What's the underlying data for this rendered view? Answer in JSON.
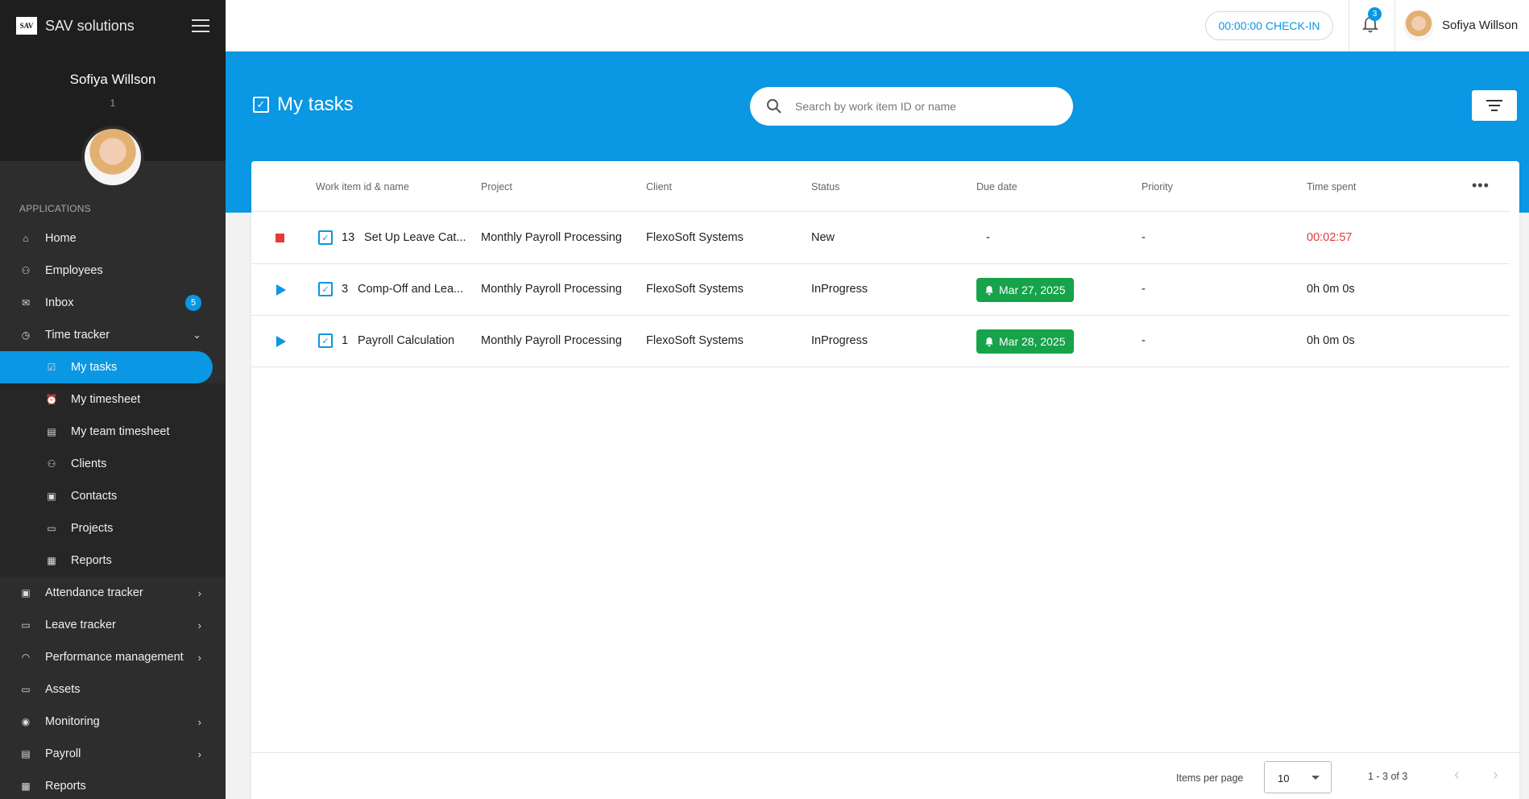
{
  "app": {
    "logo_text": "SAV",
    "brand": "SAV solutions"
  },
  "profile": {
    "name": "Sofiya Willson",
    "id": "1"
  },
  "sidebar": {
    "section_label": "APPLICATIONS",
    "items": [
      {
        "label": "Home",
        "icon": "home-icon"
      },
      {
        "label": "Employees",
        "icon": "people-icon"
      },
      {
        "label": "Inbox",
        "icon": "mail-icon",
        "badge": "5"
      },
      {
        "label": "Time tracker",
        "icon": "clock-icon"
      },
      {
        "label": "My tasks",
        "icon": "task-check-icon"
      },
      {
        "label": "My timesheet",
        "icon": "alarm-icon"
      },
      {
        "label": "My team timesheet",
        "icon": "sheet-icon"
      },
      {
        "label": "Clients",
        "icon": "people-icon"
      },
      {
        "label": "Contacts",
        "icon": "contact-icon"
      },
      {
        "label": "Projects",
        "icon": "folder-icon"
      },
      {
        "label": "Reports",
        "icon": "report-icon"
      },
      {
        "label": "Attendance tracker",
        "icon": "calendar-check-icon"
      },
      {
        "label": "Leave tracker",
        "icon": "calendar-icon"
      },
      {
        "label": "Performance management",
        "icon": "gauge-icon"
      },
      {
        "label": "Assets",
        "icon": "asset-icon"
      },
      {
        "label": "Monitoring",
        "icon": "eye-icon"
      },
      {
        "label": "Payroll",
        "icon": "payroll-icon"
      },
      {
        "label": "Reports",
        "icon": "report-icon"
      }
    ]
  },
  "topbar": {
    "checkin_label": "00:00:00 CHECK-IN",
    "notification_count": "3",
    "user_name": "Sofiya Willson"
  },
  "page": {
    "title": "My tasks",
    "search_placeholder": "Search by work item ID or name"
  },
  "table": {
    "columns": [
      "Work item id & name",
      "Project",
      "Client",
      "Status",
      "Due date",
      "Priority",
      "Time spent"
    ],
    "rows": [
      {
        "state": "running",
        "id": "13",
        "name": "Set Up Leave Cat...",
        "project": "Monthly Payroll Processing",
        "client": "FlexoSoft Systems",
        "status": "New",
        "due": "-",
        "priority": "-",
        "time": "00:02:57"
      },
      {
        "state": "stopped",
        "id": "3",
        "name": "Comp-Off and Lea...",
        "project": "Monthly Payroll Processing",
        "client": "FlexoSoft Systems",
        "status": "InProgress",
        "due": "Mar 27, 2025",
        "priority": "-",
        "time": "0h 0m 0s"
      },
      {
        "state": "stopped",
        "id": "1",
        "name": "Payroll Calculation",
        "project": "Monthly Payroll Processing",
        "client": "FlexoSoft Systems",
        "status": "InProgress",
        "due": "Mar 28, 2025",
        "priority": "-",
        "time": "0h 0m 0s"
      }
    ]
  },
  "paginator": {
    "items_per_page_label": "Items per page",
    "page_size": "10",
    "range": "1 - 3 of 3"
  },
  "colors": {
    "accent": "#0a97e3",
    "sidebar_bg": "#2d2d2d",
    "due_badge": "#16a34a",
    "running": "#e53935"
  }
}
